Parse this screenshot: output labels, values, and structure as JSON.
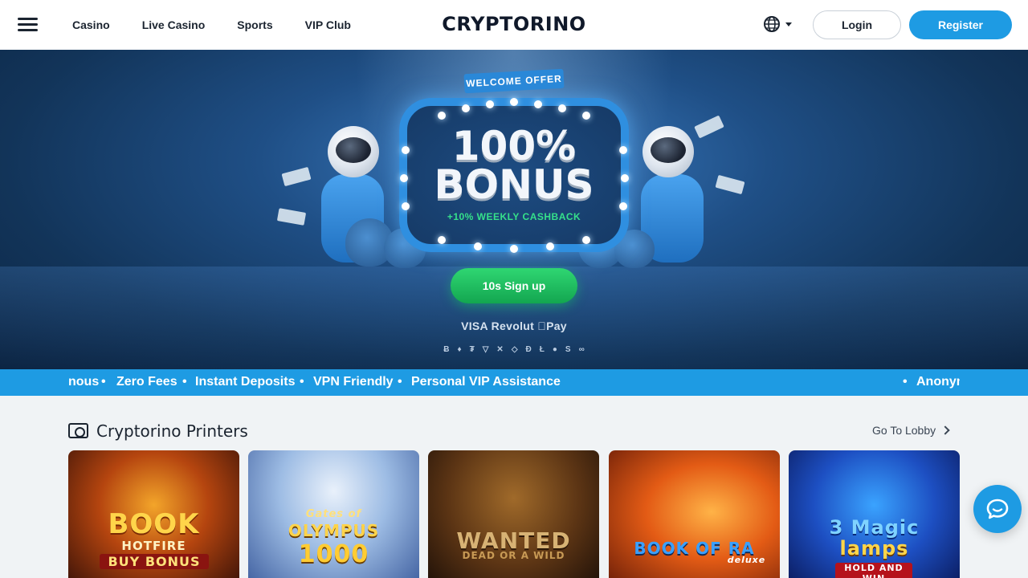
{
  "header": {
    "nav": [
      "Casino",
      "Live Casino",
      "Sports",
      "VIP Club"
    ],
    "logo": "CRYPTORINO",
    "login": "Login",
    "register": "Register"
  },
  "hero": {
    "ribbon": "WELCOME OFFER",
    "bonus_line1": "100%",
    "bonus_line2": "BONUS",
    "bonus_sub": "+10% WEEKLY CASHBACK",
    "cta": "10s Sign up",
    "payments": "VISA  Revolut  Pay",
    "crypto_symbols": [
      "Ƀ",
      "♦",
      "₮",
      "▽",
      "✕",
      "◇",
      "Ð",
      "Ł",
      "●",
      "S",
      "∞"
    ]
  },
  "ticker": {
    "items": [
      "nous",
      "Zero Fees",
      "Instant Deposits",
      "VPN Friendly",
      "Personal VIP Assistance",
      "Anonym"
    ],
    "separator": "•"
  },
  "section": {
    "title": "Cryptorino Printers",
    "lobby_link": "Go To Lobby"
  },
  "games": [
    {
      "line1": "BOOK",
      "line2": "HOTFIRE",
      "line3": "BUY BONUS"
    },
    {
      "line1": "Gates of",
      "line2": "OLYMPUS",
      "line3": "1000"
    },
    {
      "line1": "WANTED",
      "line2": "DEAD OR A WILD",
      "line3": ""
    },
    {
      "line1": "BOOK OF RA",
      "line2": "deluxe",
      "line3": ""
    },
    {
      "line1": "3 Magic",
      "line2": "lamps",
      "line3": "HOLD AND WIN"
    }
  ],
  "colors": {
    "accent": "#1e9be3",
    "cta_green": "#1fbf5f",
    "dark_text": "#1b2430"
  },
  "icons": {
    "menu": "hamburger-icon",
    "language": "globe-icon",
    "section": "banknote-icon",
    "chat": "chat-bubble-icon"
  }
}
